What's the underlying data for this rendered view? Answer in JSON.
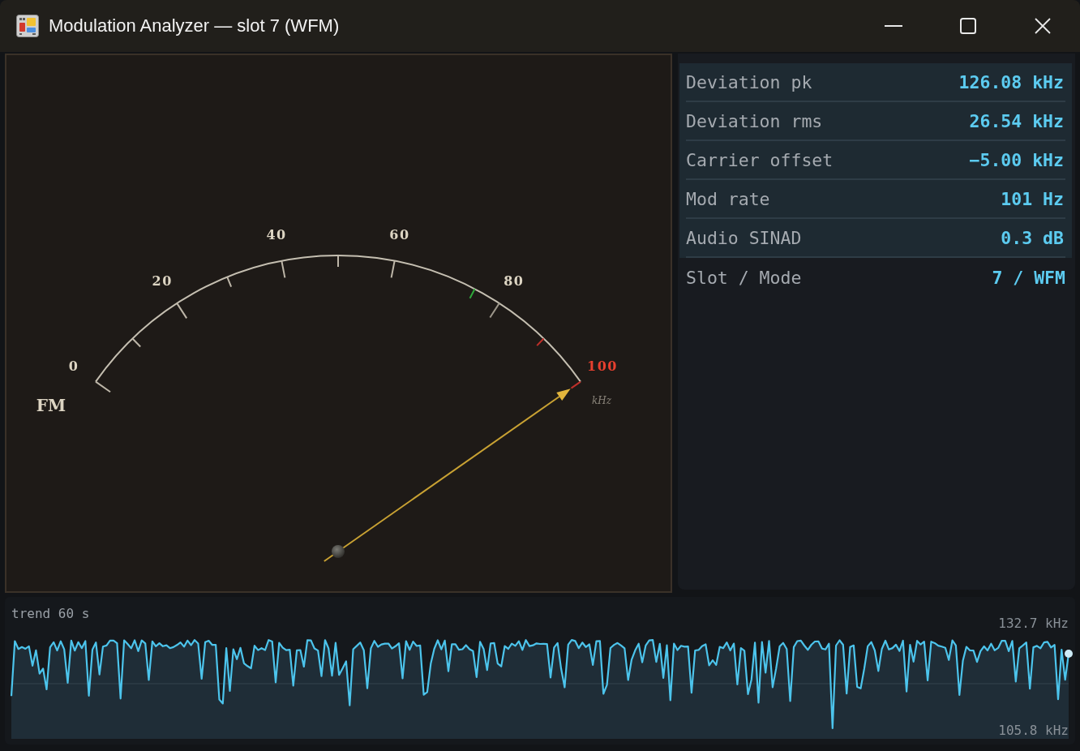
{
  "window": {
    "title": "Modulation Analyzer — slot 7 (WFM)"
  },
  "gauge": {
    "mode_label": "FM",
    "unit": "kHz",
    "scale_labels": [
      {
        "text": "0",
        "kind": "major"
      },
      {
        "text": "20",
        "kind": "major"
      },
      {
        "text": "40",
        "kind": "major"
      },
      {
        "text": "60",
        "kind": "major"
      },
      {
        "text": "80",
        "kind": "major"
      },
      {
        "text": "100",
        "kind": "limit"
      }
    ],
    "level": 1
  },
  "readouts": [
    {
      "label": "Deviation pk",
      "value": "126.08 kHz"
    },
    {
      "label": "Deviation rms",
      "value": "26.54 kHz"
    },
    {
      "label": "Carrier offset",
      "value": "−5.00 kHz"
    },
    {
      "label": "Mod rate",
      "value": "101 Hz"
    },
    {
      "label": "Audio SINAD",
      "value": "0.3 dB"
    }
  ],
  "slot_mode": {
    "label": "Slot / Mode",
    "value": "7 / WFM"
  },
  "trend": {
    "title": "trend 60 s",
    "max_label": "132.7 kHz",
    "min_label": "105.8 kHz"
  }
}
